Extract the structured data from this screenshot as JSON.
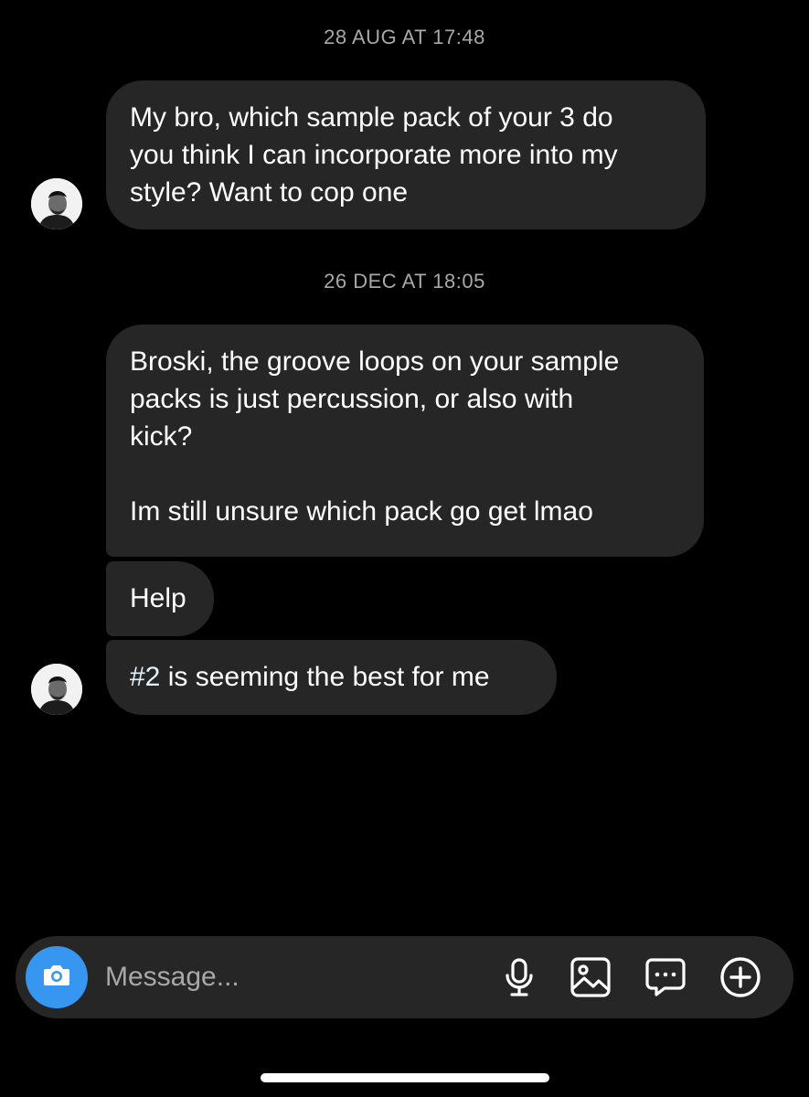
{
  "thread": {
    "timestamps": [
      "28 AUG AT 17:48",
      "26 DEC AT 18:05"
    ],
    "messages": [
      {
        "text": "My bro, which sample pack of your 3 do\nyou think I can incorporate more into my\nstyle? Want to cop one"
      },
      {
        "text": "Broski, the groove loops on your sample\npacks is just percussion, or also with\nkick?\n\nIm still unsure which pack go get lmao"
      },
      {
        "text": "Help"
      },
      {
        "hashtag": "#2",
        "text": " is seeming the best for me"
      }
    ]
  },
  "composer": {
    "placeholder": "Message...",
    "icons": [
      "camera-icon",
      "microphone-icon",
      "gallery-icon",
      "sticker-icon",
      "add-icon"
    ]
  },
  "colors": {
    "background": "#000000",
    "bubble": "#262626",
    "timestamp": "#a8a8a8",
    "accent": "#3797f0"
  }
}
